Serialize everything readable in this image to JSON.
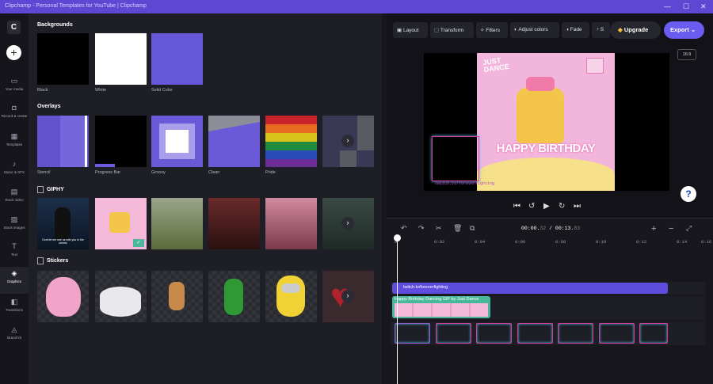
{
  "app": {
    "title": "Clipchamp - Personal Templates for YouTube | Clipchamp"
  },
  "window_controls": {
    "minimize": "—",
    "maximize": "☐",
    "close": "✕"
  },
  "nav": {
    "logo": "C",
    "add": "+",
    "items": [
      {
        "label": "Your media",
        "icon": "folder-icon",
        "glyph": "▭"
      },
      {
        "label": "Record & create",
        "icon": "camera-icon",
        "glyph": "◘"
      },
      {
        "label": "Templates",
        "icon": "templates-icon",
        "glyph": "▦"
      },
      {
        "label": "Music & SFX",
        "icon": "music-icon",
        "glyph": "♪"
      },
      {
        "label": "Stock video",
        "icon": "film-icon",
        "glyph": "▤"
      },
      {
        "label": "Stock images",
        "icon": "image-icon",
        "glyph": "▨"
      },
      {
        "label": "Text",
        "icon": "text-icon",
        "glyph": "T"
      },
      {
        "label": "Graphics",
        "icon": "shapes-icon",
        "glyph": "◈",
        "active": true
      },
      {
        "label": "Transitions",
        "icon": "transitions-icon",
        "glyph": "◧"
      },
      {
        "label": "Brand kit",
        "icon": "brand-icon",
        "glyph": "◬"
      }
    ]
  },
  "library": {
    "backgrounds": {
      "title": "Backgrounds",
      "items": [
        {
          "label": "Black"
        },
        {
          "label": "White"
        },
        {
          "label": "Solid Color"
        }
      ]
    },
    "overlays": {
      "title": "Overlays",
      "items": [
        {
          "label": "Stencil"
        },
        {
          "label": "Progress Bar"
        },
        {
          "label": "Groovy"
        },
        {
          "label": "Clean"
        },
        {
          "label": "Pride"
        }
      ],
      "more": "›"
    },
    "giphy": {
      "title": "GIPHY",
      "more": "›",
      "tile1_caption": "Dont let me see us with you in the streets"
    },
    "stickers": {
      "title": "Stickers",
      "more": "›"
    }
  },
  "toolbar": {
    "layout": "Layout",
    "transform": "Transform",
    "filters": "Filters",
    "adjust": "Adjust colors",
    "fade": "Fade",
    "speed": "S",
    "upgrade": "Upgrade",
    "export": "Export"
  },
  "preview": {
    "ratio": "16:9",
    "overlay_line1": "JUST",
    "overlay_line2": "DANCE",
    "headline": "HAPPY BIRTHDAY",
    "url_text": "twitch.tv/foreverfighting",
    "help": "?"
  },
  "timeline": {
    "time_current": "00:00.",
    "time_current_frac": "32",
    "time_sep": " / ",
    "time_total": "00:13.",
    "time_total_frac": "83",
    "ticks": [
      "0",
      "0:02",
      "0:04",
      "0:06",
      "0:08",
      "0:10",
      "0:12",
      "0:14",
      "0:16"
    ],
    "text_clip": "twitch.tv/foreverfighting",
    "gif_clip": "Happy Birthday Dancing GIF by Just Dance"
  }
}
